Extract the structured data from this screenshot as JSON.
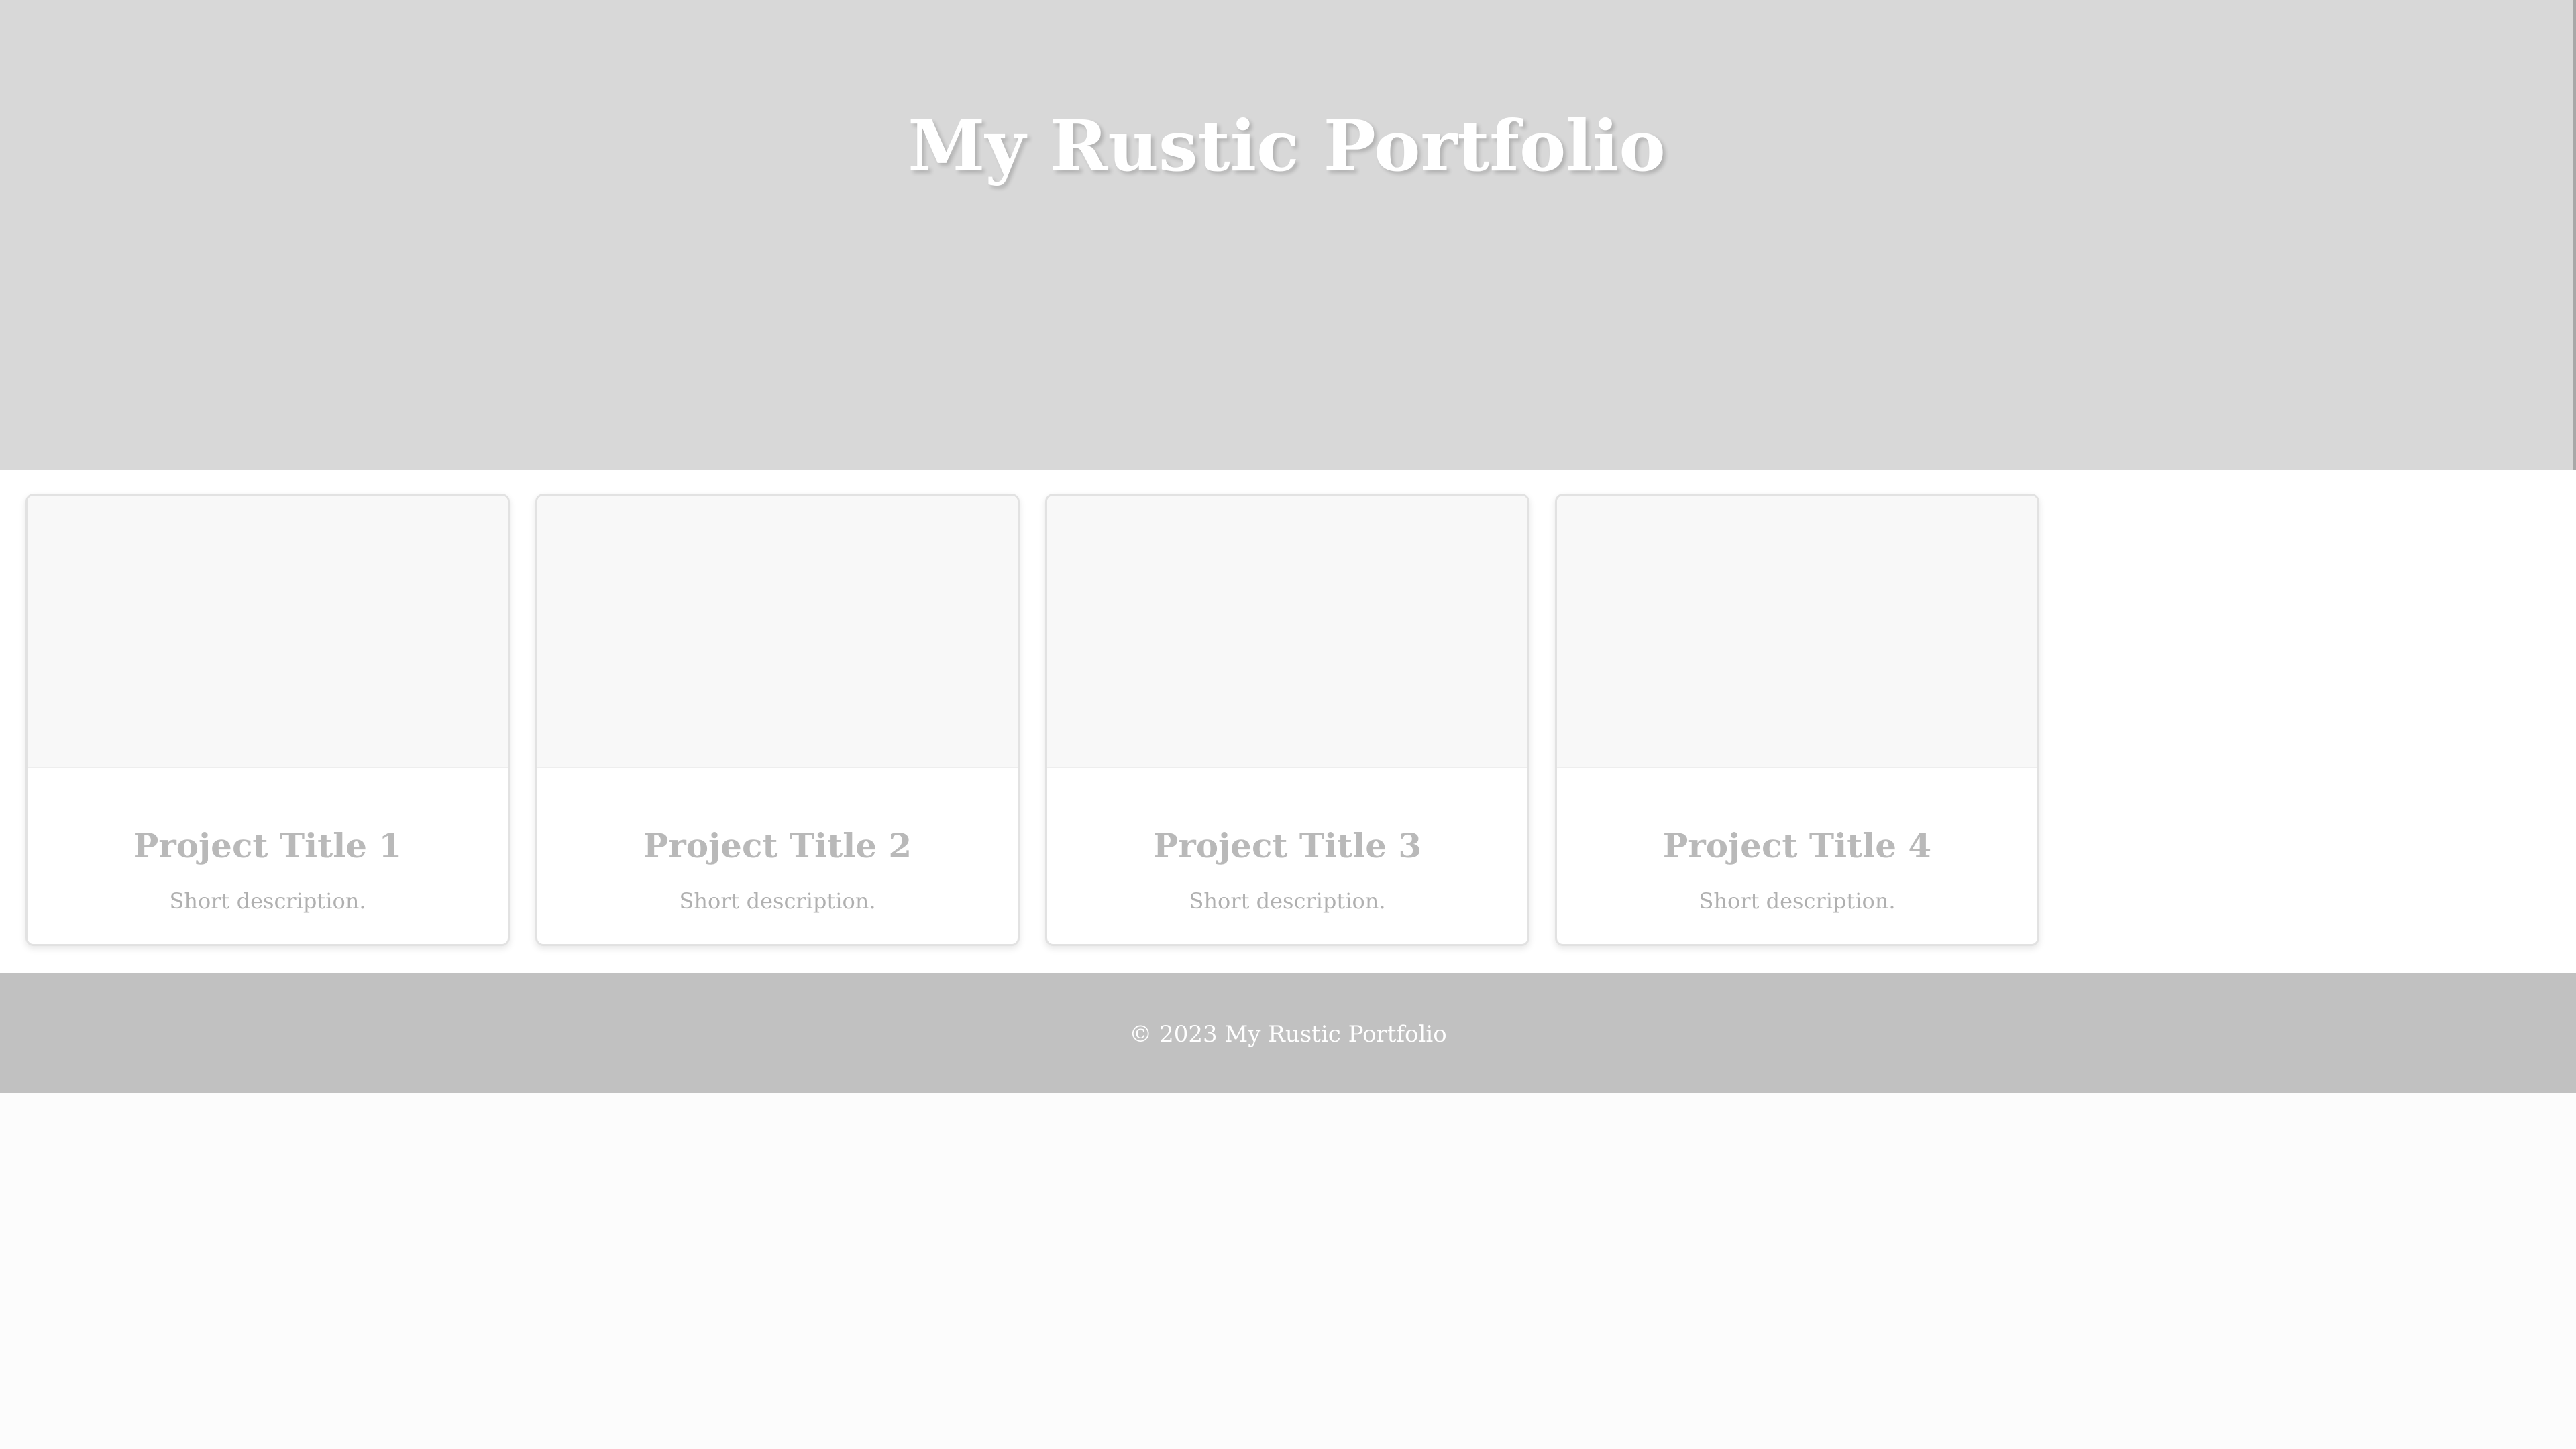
{
  "header": {
    "title": "My Rustic Portfolio"
  },
  "projects": [
    {
      "title": "Project Title 1",
      "description": "Short description."
    },
    {
      "title": "Project Title 2",
      "description": "Short description."
    },
    {
      "title": "Project Title 3",
      "description": "Short description."
    },
    {
      "title": "Project Title 4",
      "description": "Short description."
    }
  ],
  "footer": {
    "text": "© 2023 My Rustic Portfolio"
  },
  "colors": {
    "hero_background": "#d8d8d8",
    "footer_background": "#c1c1c1",
    "card_title": "#b9b9b9"
  }
}
